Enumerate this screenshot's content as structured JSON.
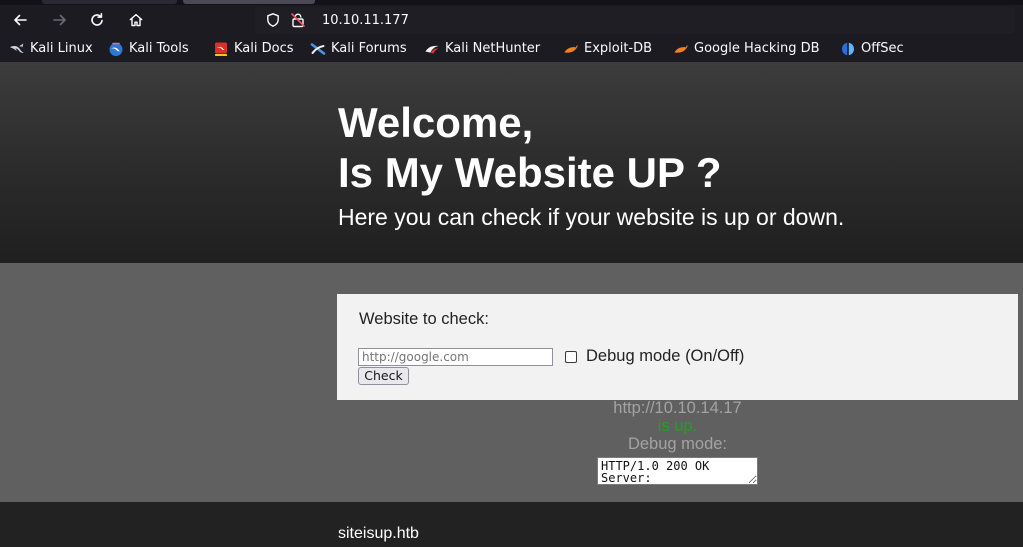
{
  "browser": {
    "nav": {
      "back_icon": "arrow-left-icon",
      "forward_icon": "arrow-right-icon",
      "reload_icon": "reload-icon",
      "home_icon": "home-icon"
    },
    "url": "10.10.11.177",
    "url_icons": [
      "shield-icon",
      "insecure-lock-icon"
    ],
    "bookmarks": [
      {
        "label": "Kali Linux",
        "icon": "kali-dragon-icon"
      },
      {
        "label": "Kali Tools",
        "icon": "kali-tools-icon"
      },
      {
        "label": "Kali Docs",
        "icon": "kali-docs-icon"
      },
      {
        "label": "Kali Forums",
        "icon": "kali-forums-icon"
      },
      {
        "label": "Kali NetHunter",
        "icon": "kali-nethunter-icon"
      },
      {
        "label": "Exploit-DB",
        "icon": "exploit-db-icon"
      },
      {
        "label": "Google Hacking DB",
        "icon": "exploit-db-icon"
      },
      {
        "label": "OffSec",
        "icon": "offsec-icon"
      }
    ]
  },
  "page": {
    "hero": {
      "title_line1": "Welcome,",
      "title_line2": "Is My Website UP ?",
      "subtitle": "Here you can check if your website is up or down."
    },
    "form": {
      "label": "Website to check:",
      "url_value": "",
      "url_placeholder": "http://google.com",
      "debug_label": "Debug mode (On/Off)",
      "debug_checked": false,
      "submit_label": "Check"
    },
    "result": {
      "checked_url": "http://10.10.14.17",
      "status": "is up.",
      "debug_heading": "Debug mode:",
      "debug_output": "HTTP/1.0 200 OK\nServer:"
    },
    "footer": {
      "domain": "siteisup.htb"
    }
  },
  "colors": {
    "hero_text": "#ffffff",
    "status_up": "#22a022",
    "section_bg": "#606060",
    "panel_bg": "#f2f2f2",
    "footer_bg": "#222222"
  }
}
